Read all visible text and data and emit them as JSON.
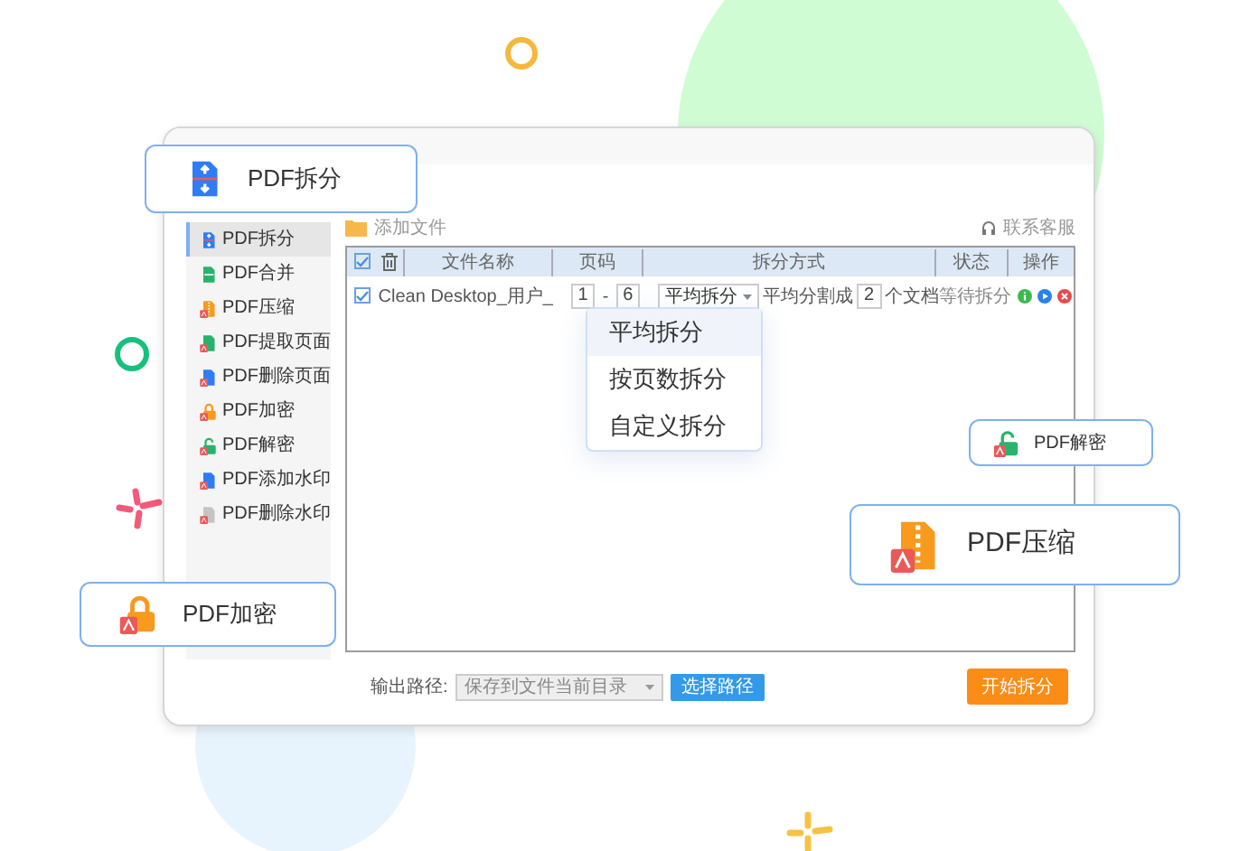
{
  "feature_cards": [
    {
      "label": "PDF拆分",
      "kind": "split"
    },
    {
      "label": "PDF加密",
      "kind": "encrypt"
    },
    {
      "label": "PDF解密",
      "kind": "decrypt"
    },
    {
      "label": "PDF压缩",
      "kind": "compress"
    }
  ],
  "app": {
    "sidebar": {
      "items": [
        {
          "label": "PDF拆分",
          "kind": "split",
          "selected": true
        },
        {
          "label": "PDF合并",
          "kind": "merge",
          "selected": false
        },
        {
          "label": "PDF压缩",
          "kind": "compress",
          "selected": false
        },
        {
          "label": "PDF提取页面",
          "kind": "extract",
          "selected": false
        },
        {
          "label": "PDF删除页面",
          "kind": "delete_pages",
          "selected": false
        },
        {
          "label": "PDF加密",
          "kind": "encrypt",
          "selected": false
        },
        {
          "label": "PDF解密",
          "kind": "decrypt",
          "selected": false
        },
        {
          "label": "PDF添加水印",
          "kind": "add_watermark",
          "selected": false
        },
        {
          "label": "PDF删除水印",
          "kind": "remove_watermark",
          "selected": false
        }
      ]
    },
    "toolbar": {
      "add_file": "添加文件",
      "support": "联系客服"
    },
    "table": {
      "header_checked": true,
      "columns": [
        "文件名称",
        "页码",
        "拆分方式",
        "状态",
        "操作"
      ],
      "rows": [
        {
          "checked": true,
          "file_name": "Clean Desktop_用户_",
          "page_from": "1",
          "page_separator": "-",
          "page_to": "6",
          "split_mode": "平均拆分",
          "split_prefix": "平均分割成",
          "split_count": "2",
          "split_suffix": "个文档",
          "status": "等待拆分"
        }
      ]
    },
    "split_menu": {
      "options": [
        {
          "label": "平均拆分",
          "selected": true
        },
        {
          "label": "按页数拆分",
          "selected": false
        },
        {
          "label": "自定义拆分",
          "selected": false
        }
      ]
    },
    "output": {
      "label": "输出路径:",
      "path": "保存到文件当前目录",
      "browse_button": "选择路径"
    },
    "start_button": "开始拆分"
  }
}
